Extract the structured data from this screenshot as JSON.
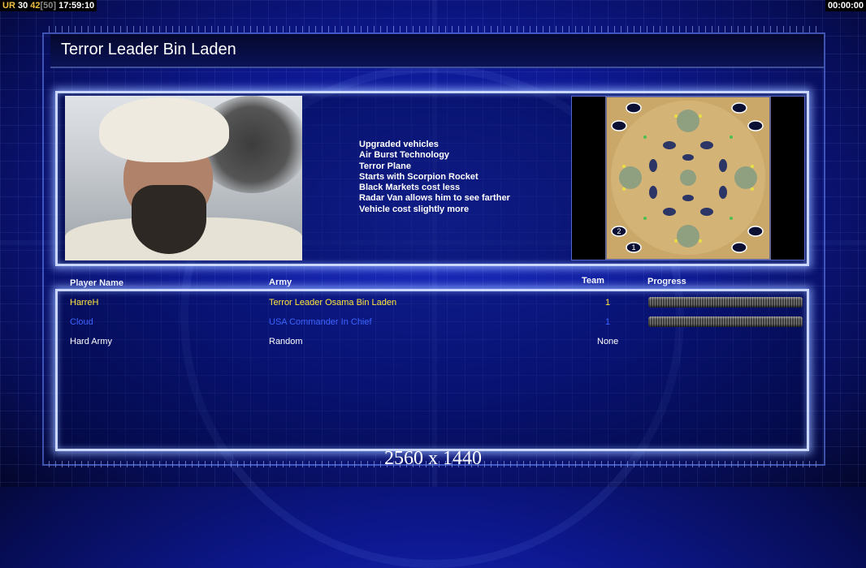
{
  "hud": {
    "tag": "UR",
    "value_a": "30",
    "value_b": "42",
    "value_c": "[50]",
    "clock": "17:59:10",
    "timer": "00:00:00"
  },
  "title": "Terror Leader Bin Laden",
  "portrait_icon": "general-portrait",
  "traits": [
    "Upgraded vehicles",
    "Air Burst Technology",
    "Terror Plane",
    "Starts with Scorpion Rocket",
    "Black Markets cost less",
    "Radar Van allows him to see farther",
    "Vehicle cost slightly more"
  ],
  "minimap": {
    "start_markers": [
      "2",
      "1"
    ]
  },
  "table": {
    "headers": {
      "player_name": "Player Name",
      "army": "Army",
      "team": "Team",
      "progress": "Progress"
    },
    "rows": [
      {
        "player": "HarreH",
        "army": "Terror Leader Osama Bin Laden",
        "team": "1",
        "color": "#ffe63a",
        "has_progress": true
      },
      {
        "player": "Cloud",
        "army": "USA Commander In Chief",
        "team": "1",
        "color": "#3c63ff",
        "has_progress": true
      },
      {
        "player": "Hard Army",
        "army": "Random",
        "team": "None",
        "color": "#ffffff",
        "has_progress": false
      }
    ]
  },
  "resolution_label": "2560 x 1440"
}
